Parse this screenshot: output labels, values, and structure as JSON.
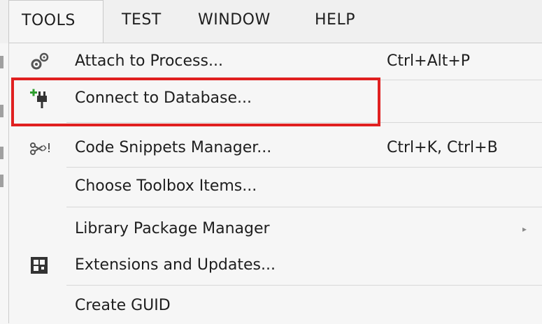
{
  "menubar": {
    "items": [
      {
        "label": "TOOLS"
      },
      {
        "label": "TEST"
      },
      {
        "label": "WINDOW"
      },
      {
        "label": "HELP"
      }
    ]
  },
  "menu": {
    "items": [
      {
        "label": "Attach to Process...",
        "shortcut": "Ctrl+Alt+P",
        "icon": "attach-process-icon"
      },
      {
        "label": "Connect to Database...",
        "shortcut": "",
        "icon": "connect-database-icon"
      },
      {
        "label": "Code Snippets Manager...",
        "shortcut": "Ctrl+K, Ctrl+B",
        "icon": "code-snippets-icon"
      },
      {
        "label": "Choose Toolbox Items...",
        "shortcut": "",
        "icon": ""
      },
      {
        "label": "Library Package Manager",
        "shortcut": "",
        "icon": "",
        "submenu_arrow": "▸"
      },
      {
        "label": "Extensions and Updates...",
        "shortcut": "",
        "icon": "extensions-icon"
      },
      {
        "label": "Create GUID",
        "shortcut": "",
        "icon": ""
      }
    ]
  },
  "colors": {
    "highlight_border": "#e02020",
    "menu_background": "#f6f6f6",
    "text": "#1e1e1e"
  }
}
